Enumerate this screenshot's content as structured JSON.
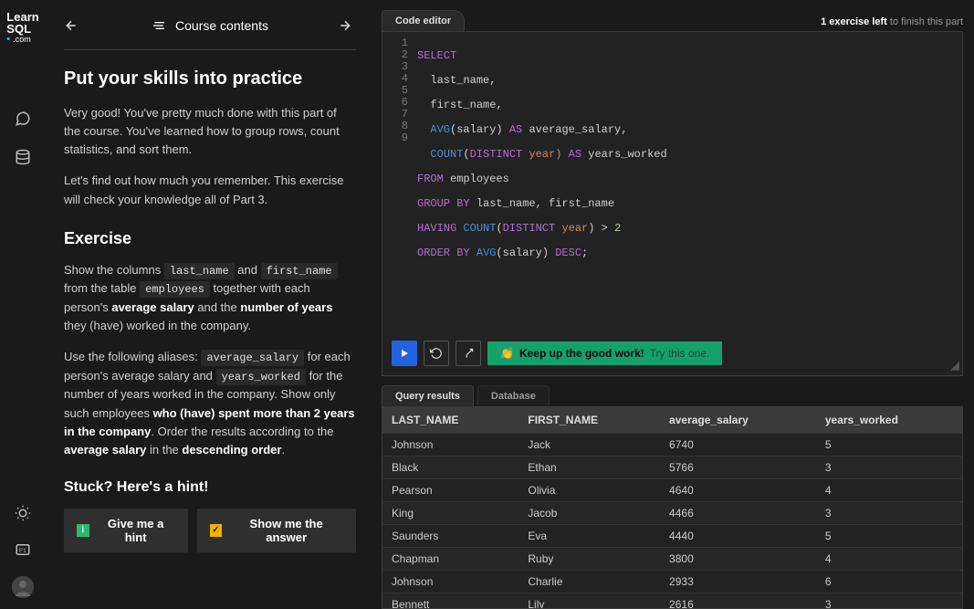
{
  "logo": {
    "line1": "Learn",
    "line2": "SQL",
    "line3": ".com"
  },
  "rail": {
    "chat": "chat-icon",
    "db": "database-icon",
    "theme": "theme-icon",
    "window": "window-icon",
    "avatar": "avatar"
  },
  "nav": {
    "title": "Course contents"
  },
  "lesson": {
    "heading": "Put your skills into practice",
    "p1": "Very good! You've pretty much done with this part of the course. You've learned how to group rows, count statistics, and sort them.",
    "p2": "Let's find out how much you remember. This exercise will check your knowledge all of Part 3.",
    "exercise_h": "Exercise",
    "ex_txt1a": "Show the columns ",
    "ex_code1": "last_name",
    "ex_txt1b": " and ",
    "ex_code2": "first_name",
    "ex_txt1c": " from the table ",
    "ex_code3": "employees",
    "ex_txt1d": " together with each person's ",
    "ex_b1": "average salary",
    "ex_txt1e": " and the ",
    "ex_b2": "number of years",
    "ex_txt1f": " they (have) worked in the company.",
    "ex_txt2a": "Use the following aliases: ",
    "ex_code4": "average_salary",
    "ex_txt2b": " for each person's average salary and ",
    "ex_code5": "years_worked",
    "ex_txt2c": " for the number of years worked in the company. Show only such employees ",
    "ex_b3": "who (have) spent more than 2 years in the company",
    "ex_txt2d": ". Order the results according to the ",
    "ex_b4": "average salary",
    "ex_txt2e": " in the ",
    "ex_b5": "descending order",
    "ex_txt2f": ".",
    "hint_h": "Stuck? Here's a hint!",
    "hint_btn": "Give me a hint",
    "answer_btn": "Show me the answer"
  },
  "editor": {
    "tab": "Code editor",
    "exercises_left_b": "1 exercise left",
    "exercises_left_r": " to finish this part",
    "code": {
      "l1": {
        "k": "SELECT"
      },
      "l2": {
        "t": "last_name,"
      },
      "l3": {
        "t": "first_name,"
      },
      "l4": {
        "f": "AVG",
        "a": "(salary)",
        "as": "AS",
        "al": "average_salary,"
      },
      "l5": {
        "f": "COUNT",
        "o": "(",
        "d": "DISTINCT",
        "arg": " year)",
        "as": "AS",
        "al": "years_worked"
      },
      "l6": {
        "k": "FROM",
        "t": "employees"
      },
      "l7": {
        "k": "GROUP BY",
        "t": "last_name, first_name"
      },
      "l8": {
        "k": "HAVING",
        "f": "COUNT",
        "o": "(",
        "d": "DISTINCT",
        "arg": " year",
        "c": ")",
        "gt": ">",
        "n": "2"
      },
      "l9": {
        "k": "ORDER BY",
        "f": "AVG",
        "a": "(salary)",
        "de": "DESC",
        "sc": ";"
      }
    },
    "success_emoji": "👏",
    "success_b": "Keep up the good work!",
    "success_m": "Try this one."
  },
  "results": {
    "tab1": "Query results",
    "tab2": "Database",
    "cols": [
      "LAST_NAME",
      "FIRST_NAME",
      "average_salary",
      "years_worked"
    ],
    "rows": [
      [
        "Johnson",
        "Jack",
        "6740",
        "5"
      ],
      [
        "Black",
        "Ethan",
        "5766",
        "3"
      ],
      [
        "Pearson",
        "Olivia",
        "4640",
        "4"
      ],
      [
        "King",
        "Jacob",
        "4466",
        "3"
      ],
      [
        "Saunders",
        "Eva",
        "4440",
        "5"
      ],
      [
        "Chapman",
        "Ruby",
        "3800",
        "4"
      ],
      [
        "Johnson",
        "Charlie",
        "2933",
        "6"
      ],
      [
        "Bennett",
        "Lily",
        "2616",
        "3"
      ]
    ]
  }
}
